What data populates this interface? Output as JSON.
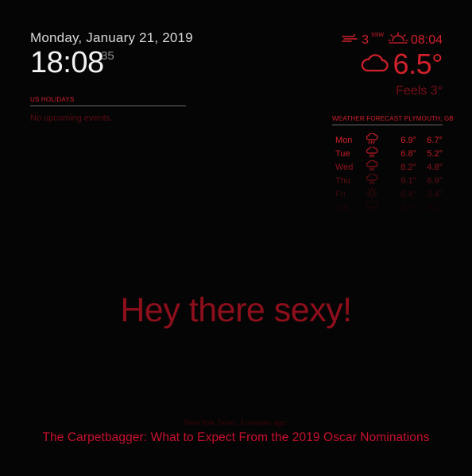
{
  "clock": {
    "date": "Monday, January 21, 2019",
    "time": "18:08",
    "seconds": "35"
  },
  "holidays": {
    "header": "US HOLIDAYS",
    "empty_text": "No upcoming events."
  },
  "current_weather": {
    "wind_icon": "wind-icon",
    "wind_speed": "3",
    "wind_direction": "SSW",
    "sun_icon": "sunset-icon",
    "sun_time": "08:04",
    "condition_icon": "cloud-icon",
    "temperature": "6.5°",
    "feels_like": "Feels 3°"
  },
  "forecast": {
    "header": "WEATHER FORECAST PLYMOUTH, GB",
    "rows": [
      {
        "day": "Mon",
        "icon": "rain-icon",
        "max": "6.9°",
        "min": "6.7°",
        "color": "#d2202c"
      },
      {
        "day": "Tue",
        "icon": "showers-icon",
        "max": "6.8°",
        "min": "5.2°",
        "color": "#c01b27"
      },
      {
        "day": "Wed",
        "icon": "showers-icon",
        "max": "8.2°",
        "min": "4.8°",
        "color": "#8f141d"
      },
      {
        "day": "Thu",
        "icon": "showers-icon",
        "max": "9.1°",
        "min": "6.9°",
        "color": "#5e0e15"
      },
      {
        "day": "Fri",
        "icon": "sun-icon",
        "max": "6.4°",
        "min": "3.4°",
        "color": "#33080c"
      },
      {
        "day": "Sat",
        "icon": "showers-icon",
        "max": "4.9°",
        "min": "3.1°",
        "color": "#1a0406"
      }
    ]
  },
  "compliment": "Hey there sexy!",
  "news": {
    "source": "New York Times, 4 minuten ago:",
    "title": "The Carpetbagger: What to Expect From the 2019 Oscar Nominations"
  },
  "colors": {
    "accent": "#d2202c",
    "background": "#000000"
  }
}
